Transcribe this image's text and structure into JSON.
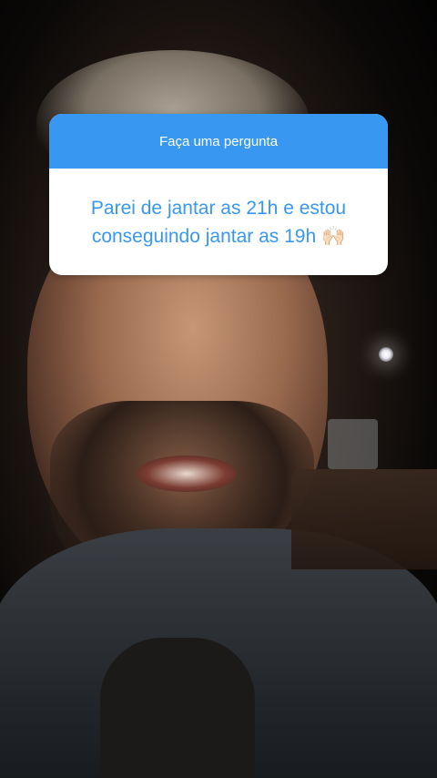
{
  "story": {
    "question_sticker": {
      "header": "Faça uma pergunta",
      "question_line1": "Parei de jantar as 21h e estou",
      "question_line2": "conseguindo jantar as 19h 🙌🏻",
      "accent_color": "#3897f0"
    },
    "background": {
      "description_icon": "selfie-video-background"
    }
  }
}
